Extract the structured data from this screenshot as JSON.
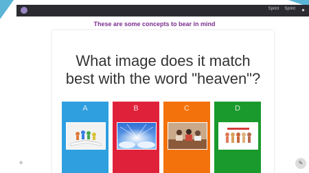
{
  "topbar": {
    "link1": "Sprint",
    "link2": "Sprint",
    "icon": "user-icon"
  },
  "banner": "These are some concepts to bear in mind",
  "question": {
    "line1": "What image does it match",
    "line2": "best with the word \"heaven\"?"
  },
  "options": [
    {
      "letter": "A",
      "color": "#2f9fe0",
      "image": "open-book-with-figures"
    },
    {
      "letter": "B",
      "color": "#e0213a",
      "image": "sky-with-light-rays"
    },
    {
      "letter": "C",
      "color": "#f4720c",
      "image": "people-at-table"
    },
    {
      "letter": "D",
      "color": "#1a9a2c",
      "image": "row-of-figures"
    }
  ],
  "colors": {
    "accent": "#5bb5d6",
    "topbar": "#2b2b31",
    "banner_text": "#7b2e8f"
  },
  "icons": {
    "side": "settings-icon",
    "fab": "pencil-icon"
  }
}
